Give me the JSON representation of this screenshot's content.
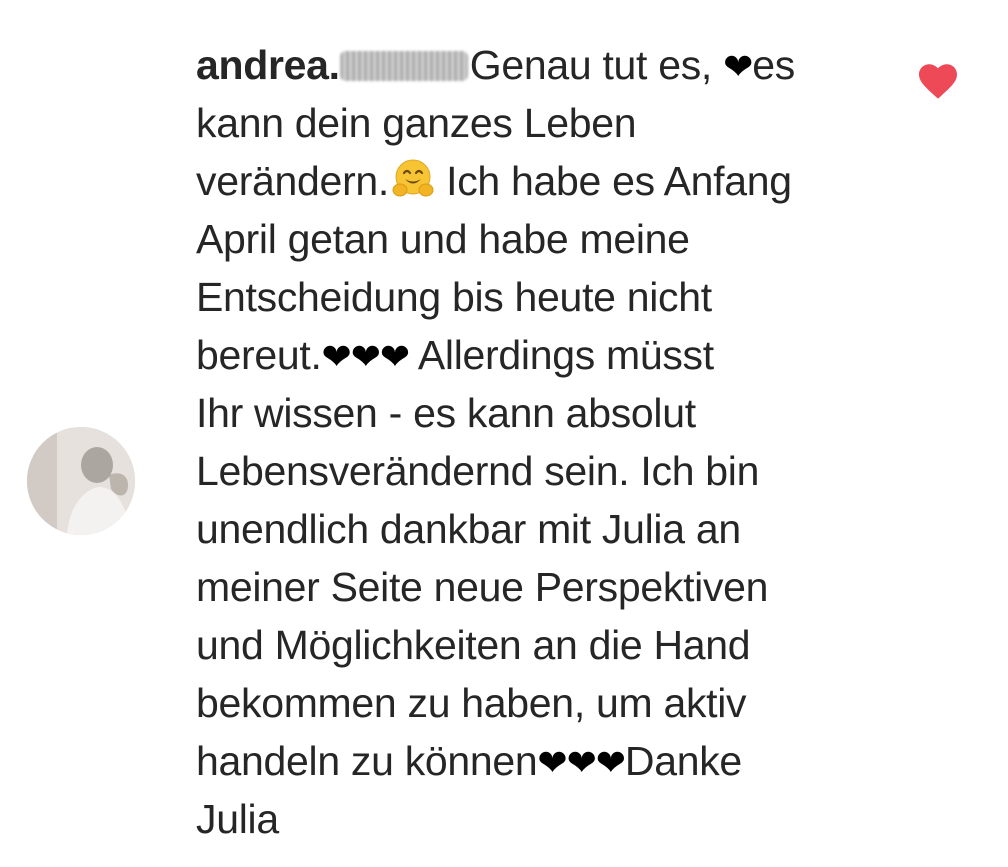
{
  "comment": {
    "username": "andrea.",
    "text_lines": [
      "Genau tut es, ",
      "es",
      "kann dein ganzes Leben",
      "verändern.",
      " Ich habe es Anfang",
      "April getan und habe meine",
      "Entscheidung bis heute nicht",
      "bereut.",
      " Allerdings müsst",
      "Ihr wissen - es kann absolut",
      "Lebensverändernd sein. Ich bin",
      "unendlich dankbar mit Julia an",
      "meiner Seite neue Perspektiven",
      "und Möglichkeiten an die Hand",
      "bekommen zu haben, um aktiv",
      "handeln zu können",
      "Danke",
      "Julia"
    ],
    "hearts": {
      "single": "❤",
      "triple": "❤❤❤"
    },
    "emoji_name": "hugging-face-emoji",
    "like_icon": "heart-icon",
    "like_color": "#ed4956",
    "text_color": "#262626"
  }
}
